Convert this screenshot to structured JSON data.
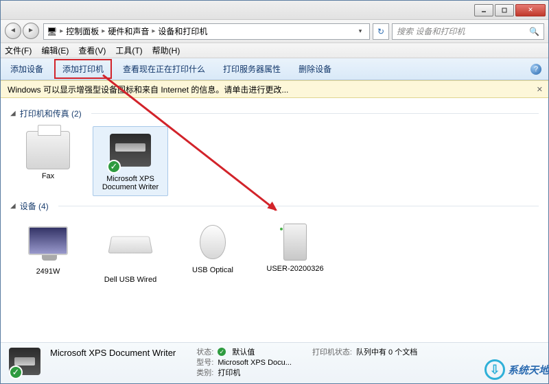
{
  "breadcrumb": {
    "root_icon": "🖥",
    "items": [
      "控制面板",
      "硬件和声音",
      "设备和打印机"
    ]
  },
  "search": {
    "placeholder": "搜索 设备和打印机"
  },
  "menu": {
    "file": "文件(F)",
    "edit": "编辑(E)",
    "view": "查看(V)",
    "tools": "工具(T)",
    "help": "帮助(H)"
  },
  "toolbar": {
    "add_device": "添加设备",
    "add_printer": "添加打印机",
    "see_printing": "查看现在正在打印什么",
    "server_props": "打印服务器属性",
    "remove_device": "删除设备"
  },
  "info_bar": "Windows 可以显示增强型设备图标和来自 Internet 的信息。请单击进行更改...",
  "groups": {
    "printers": {
      "title": "打印机和传真 (2)",
      "items": [
        {
          "label": "Fax"
        },
        {
          "label": "Microsoft XPS Document Writer"
        }
      ]
    },
    "devices": {
      "title": "设备 (4)",
      "items": [
        {
          "label": "2491W"
        },
        {
          "label": "Dell USB Wired"
        },
        {
          "label": "USB Optical"
        },
        {
          "label": "USER-20200326"
        }
      ]
    }
  },
  "details": {
    "title": "Microsoft XPS Document Writer",
    "status_label": "状态:",
    "status_value": "默认值",
    "model_label": "型号:",
    "model_value": "Microsoft XPS Docu...",
    "category_label": "类别:",
    "category_value": "打印机",
    "printer_status_label": "打印机状态:",
    "printer_status_value": "队列中有 0 个文档"
  },
  "watermark": "系统天地"
}
